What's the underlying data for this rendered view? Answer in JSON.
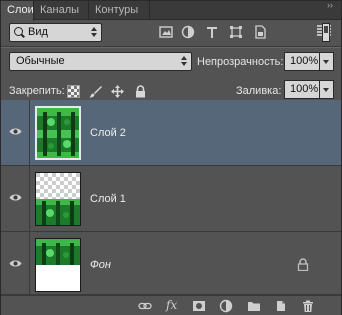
{
  "tabs": [
    {
      "label": "Слои",
      "active": true
    },
    {
      "label": "Каналы",
      "active": false
    },
    {
      "label": "Контуры",
      "active": false
    }
  ],
  "filter": {
    "kind_label": "Вид"
  },
  "blend": {
    "mode": "Обычные",
    "opacity_label": "Непрозрачность:",
    "opacity_value": "100%"
  },
  "lock": {
    "label": "Закрепить:",
    "fill_label": "Заливка:",
    "fill_value": "100%"
  },
  "layers": [
    {
      "name": "Слой 2",
      "visible": true,
      "selected": true,
      "italic": false,
      "locked": false
    },
    {
      "name": "Слой 1",
      "visible": true,
      "selected": false,
      "italic": false,
      "locked": false
    },
    {
      "name": "Фон",
      "visible": true,
      "selected": false,
      "italic": true,
      "locked": true
    }
  ],
  "bottom": {
    "fx_label": "fx"
  },
  "colors": {
    "panel_bg": "#535353",
    "selected_row": "#57677a",
    "tab_bar": "#3a3a3a"
  }
}
